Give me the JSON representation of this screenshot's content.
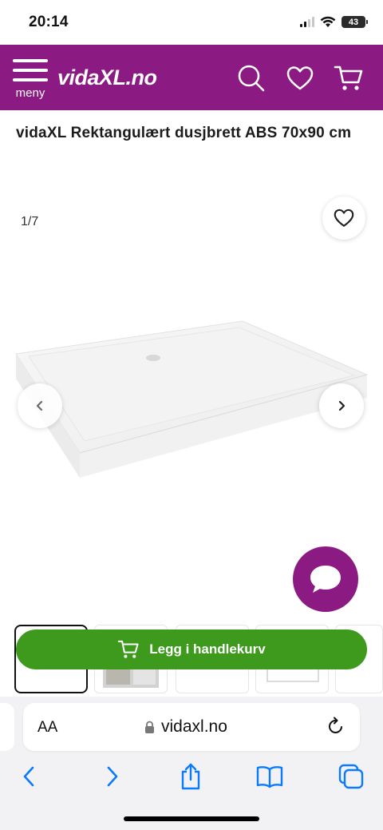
{
  "status_bar": {
    "time": "20:14",
    "battery": "43"
  },
  "header": {
    "menu_label": "meny",
    "logo_text": "vidaXL.no",
    "brand_color": "#8b1a83",
    "icons": [
      "menu-icon",
      "search-icon",
      "heart-icon",
      "cart-icon"
    ]
  },
  "product": {
    "title": "vidaXL Rektangulært dusjbrett ABS 70x90 cm"
  },
  "gallery": {
    "counter": "1/7",
    "current_image": 1,
    "total_images": 7
  },
  "cart": {
    "button_label": "Legg i handlekurv",
    "button_color": "#3e9a1c"
  },
  "browser": {
    "text_size_label": "AA",
    "url": "vidaxl.no",
    "toolbar_icons": [
      "back-icon",
      "forward-icon",
      "share-icon",
      "bookmarks-icon",
      "tabs-icon"
    ]
  }
}
